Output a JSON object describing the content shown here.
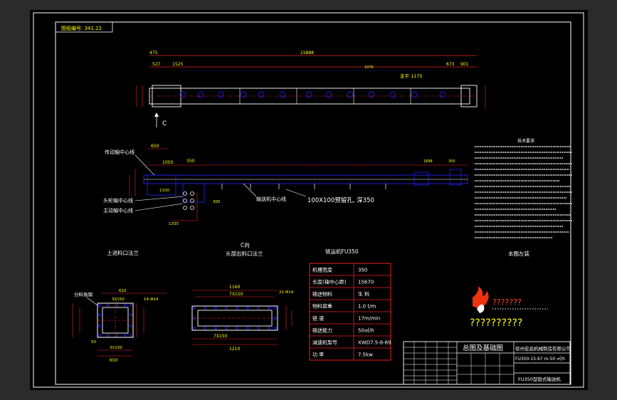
{
  "drawing": {
    "stamp": "图纸编号: 341.22",
    "title_block": {
      "title": "总图及基础图",
      "company": "徐州宏昌机械制造有限公司",
      "model": "FU350-15.67 m-50 ㎡/h",
      "name": "FU350型链式输送机"
    },
    "notes_heading": "技术要求",
    "watermark": "??????????",
    "watermark_sub": "???????"
  },
  "views": {
    "c_direction": "C",
    "c_view_title": "C向",
    "c_view_subtitle": "头部出料口法兰",
    "top_flange_title": "上进料口法兰",
    "layout_label": "本图左装",
    "drive_center": "传动轴中心线",
    "head_center": "头轮轴中心线",
    "main_center": "主动轴中心线",
    "conveyor_center": "输送机中心线",
    "steel_note": "100X100预留孔, 深350",
    "top_hole_note": "支平 1175",
    "inlet_note": "分料角钢"
  },
  "dimensions": {
    "overall_length": "15888",
    "d_475": "475",
    "d_527": "527",
    "d_1525": "1525",
    "d_1070": "1070",
    "d_673": "673",
    "d_901": "901",
    "d_650": "650",
    "d_1050": "1050",
    "d_350": "350",
    "d_1100": "1100",
    "d_610": "610",
    "d_3x150": "3X150",
    "d_14_14": "14-Φ14",
    "d_7x150": "7X150",
    "d_22_14": "22-Φ14",
    "d_1160": "1160",
    "d_1210": "1210",
    "d_50": "50"
  },
  "spec_table": {
    "title": "链运机FU350",
    "rows": [
      {
        "label": "机槽宽度",
        "value": "350"
      },
      {
        "label": "长度(轴中心距)",
        "value": "15670"
      },
      {
        "label": "输送物料",
        "value": "生 料"
      },
      {
        "label": "物料容重",
        "value": "1.0 t/m"
      },
      {
        "label": "链 速",
        "value": "17m/min"
      },
      {
        "label": "输送能力",
        "value": "50㎡/h"
      },
      {
        "label": "减速机型号",
        "value": "XWD7.5-8-69"
      },
      {
        "label": "功 率",
        "value": "7.5kw"
      }
    ]
  },
  "colors": {
    "paper": "#000000",
    "line_blue": "#2222ee",
    "line_white": "#ffffff",
    "line_red": "#ee2222",
    "text_yellow": "#ffff00",
    "frame": "#ffffff"
  }
}
